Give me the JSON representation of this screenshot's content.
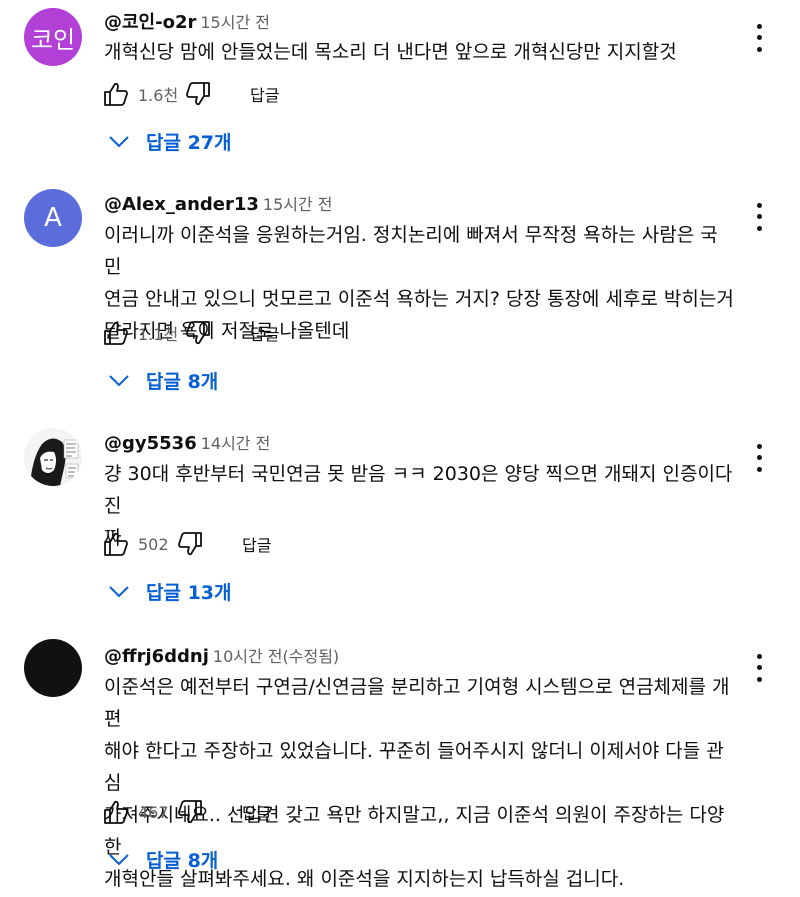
{
  "colors": {
    "accent": "#065fd4",
    "avatar_purple": "#b23fd6",
    "avatar_blue": "#5b6ddb",
    "avatar_black": "#111111"
  },
  "comments": [
    {
      "avatar_text": "코인",
      "author": "@코인-o2r",
      "time": "15시간 전",
      "lines": [
        "개혁신당 맘에 안들었는데 목소리 더 낸다면 앞으로 개혁신당만 지지할것"
      ],
      "likes": "1.6천",
      "reply_label": "답글",
      "replies": "답글 27개"
    },
    {
      "avatar_text": "A",
      "author": "@Alex_ander13",
      "time": "15시간 전",
      "lines": [
        "이러니까 이준석을 응원하는거임. 정치논리에 빠져서 무작정 욕하는 사람은 국민",
        "연금 안내고 있으니 멋모르고 이준석 욕하는 거지? 당장 통장에 세후로 박히는거",
        "달라지면 욕이 저절로 나올텐데"
      ],
      "likes": "1.1천",
      "reply_label": "답글",
      "replies": "답글 8개"
    },
    {
      "avatar_text": "",
      "author": "@gy5536",
      "time": "14시간 전",
      "lines": [
        "걍 30대 후반부터 국민연금 못 받음 ㅋㅋ 2030은 양당 찍으면 개돼지 인증이다 진",
        "짜"
      ],
      "likes": "502",
      "reply_label": "답글",
      "replies": "답글 13개"
    },
    {
      "avatar_text": "",
      "author": "@ffrj6ddnj",
      "time": "10시간 전(수정됨)",
      "lines": [
        "이준석은 예전부터 구연금/신연금을 분리하고 기여형 시스템으로 연금체제를 개편",
        "해야 한다고 주장하고 있었습니다. 꾸준히 들어주시지 않더니 이제서야 다들 관심",
        "가져주시네요.. 선입견 갖고 욕만 하지말고,, 지금 이준석 의원이 주장하는 다양한",
        "개혁안들 살펴봐주세요. 왜 이준석을 지지하는지 납득하실 겁니다."
      ],
      "likes": "467",
      "reply_label": "답글",
      "replies": "답글 8개"
    }
  ]
}
